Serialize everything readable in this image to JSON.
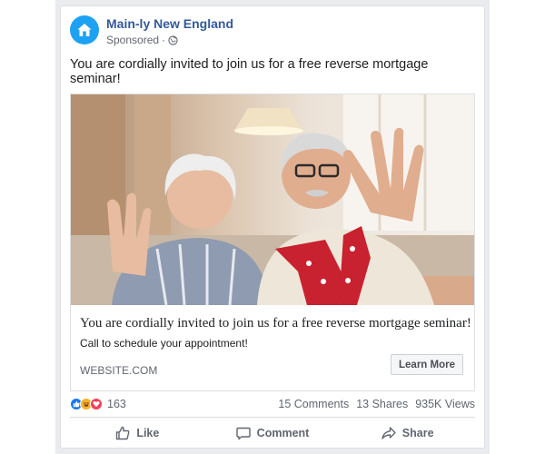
{
  "post": {
    "page_name": "Main-ly New England",
    "sponsored_label": "Sponsored",
    "sponsored_separator": "·",
    "text": "You are cordially invited to join us for a free reverse mortgage seminar!",
    "photo_icon": "seniors-waving-photo"
  },
  "link": {
    "headline": "You are cordially invited to join us for a free reverse mortgage seminar!",
    "description": "Call to schedule your appointment!",
    "domain": "WEBSITE.COM",
    "cta_label": "Learn More"
  },
  "stats": {
    "reaction_count": "163",
    "comments": "15 Comments",
    "shares": "13 Shares",
    "views": "935K Views",
    "reaction_icons": [
      "like-reaction-icon",
      "haha-reaction-icon",
      "love-reaction-icon"
    ]
  },
  "actions": {
    "like": "Like",
    "comment": "Comment",
    "share": "Share"
  },
  "colors": {
    "brand_avatar": "#1da1f2",
    "page_name": "#365899",
    "like_blue": "#1877f2",
    "love_red": "#f33e58",
    "haha_yellow": "#f7b125"
  }
}
